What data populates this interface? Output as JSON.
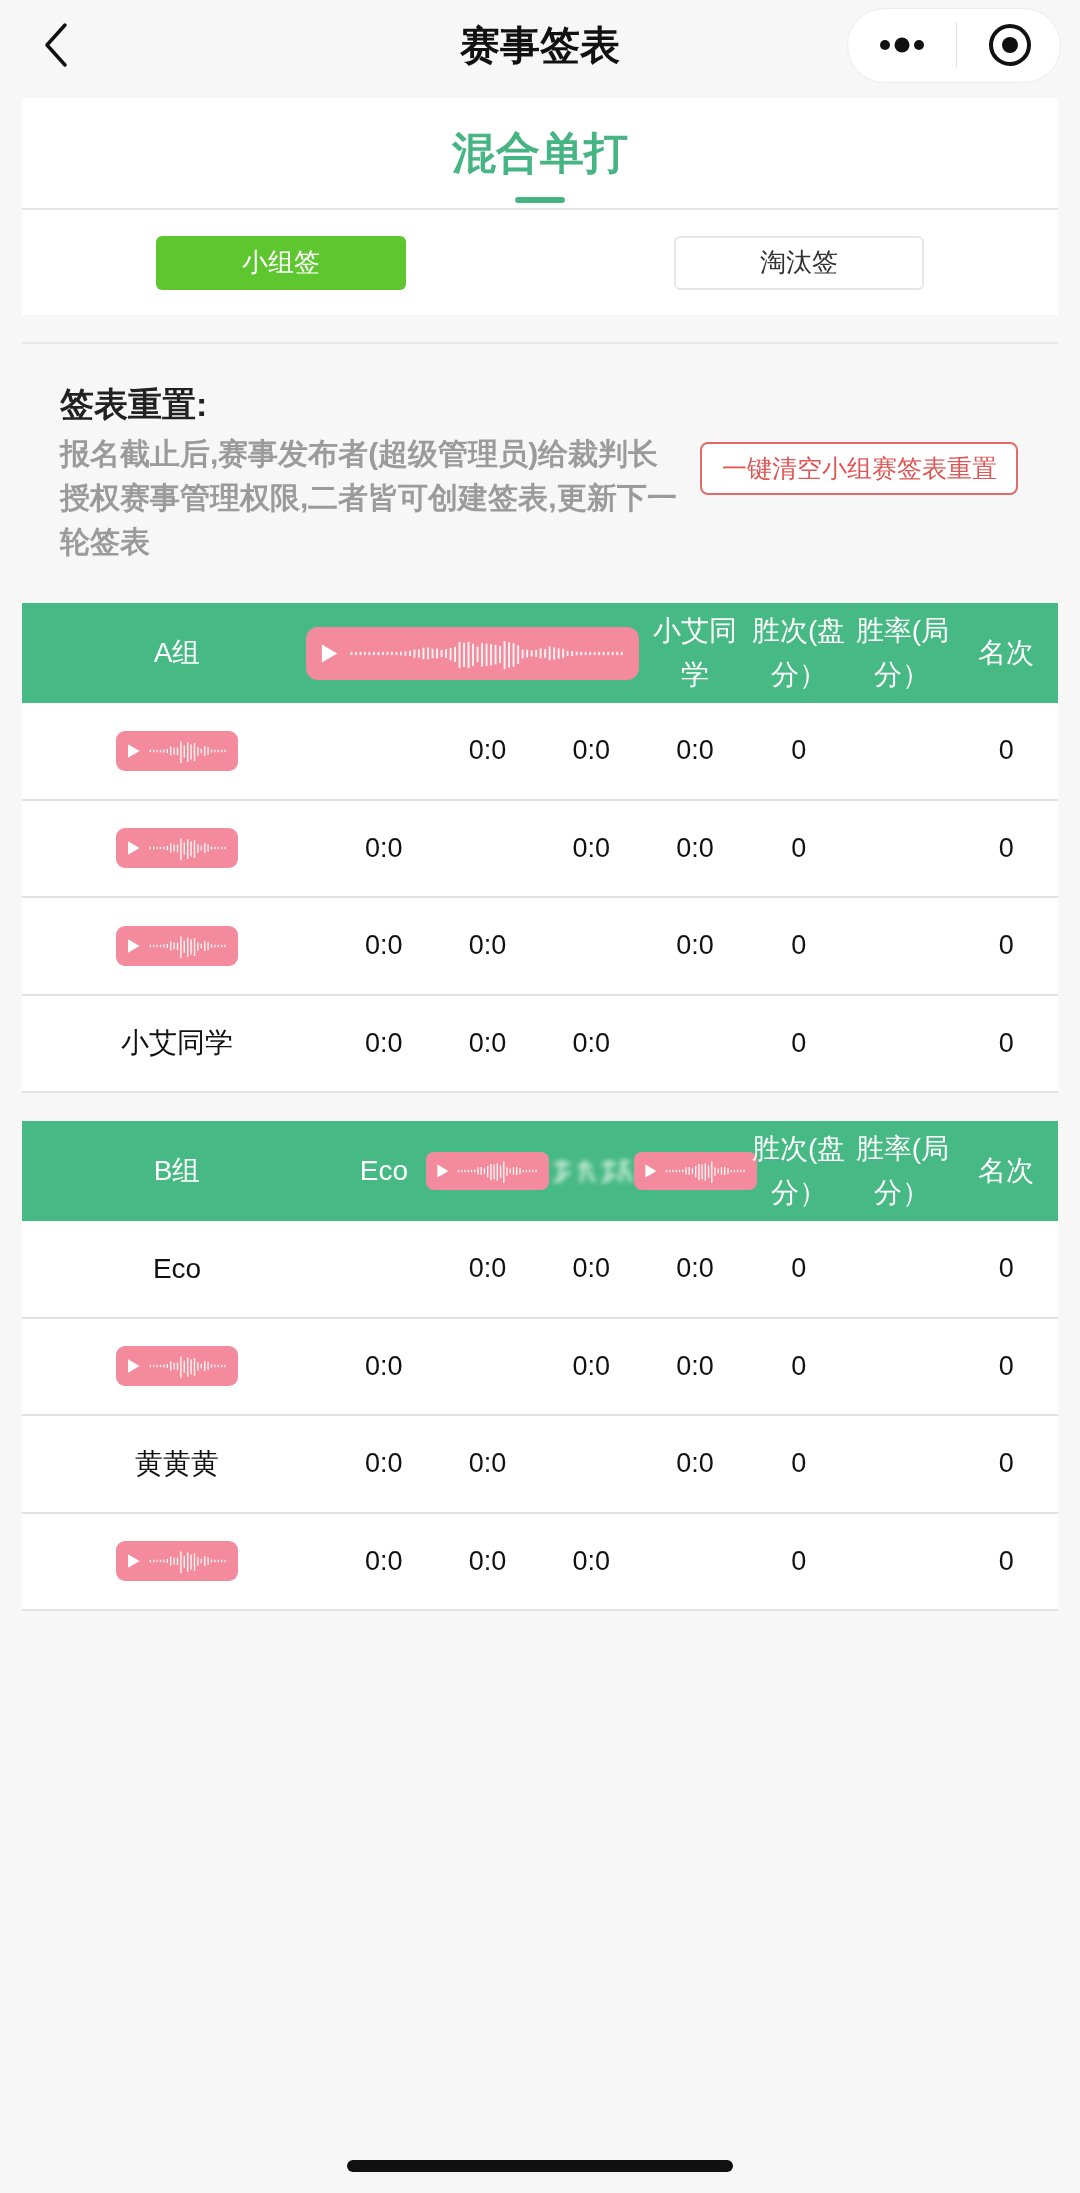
{
  "nav_bar": {
    "title": "赛事签表"
  },
  "event": {
    "title": "混合单打"
  },
  "draw_tabs": [
    {
      "label": "小组签",
      "selected": true
    },
    {
      "label": "淘汰签",
      "selected": false
    }
  ],
  "reset_section": {
    "heading": "签表重置:",
    "description": "报名截止后,赛事发布者(超级管理员)给裁判长授权赛事管理权限,二者皆可创建签表,更新下一轮签表",
    "button": "一键清空小组赛签表重置"
  },
  "groups": [
    {
      "columns": [
        {
          "kind": "text",
          "label": "A组"
        },
        {
          "kind": "wide_sticker"
        },
        {
          "kind": "text",
          "label": "小艾同学"
        },
        {
          "kind": "text",
          "label": "胜次(盘分）"
        },
        {
          "kind": "text",
          "label": "胜率(局分）"
        },
        {
          "kind": "text",
          "label": "名次"
        }
      ],
      "rows": [
        {
          "player": {
            "kind": "sticker"
          },
          "scores": [
            "0:0",
            "0:0",
            "0:0"
          ],
          "wins": "0",
          "rank": "0"
        },
        {
          "player": {
            "kind": "sticker"
          },
          "scores": [
            "0:0",
            "0:0",
            "0:0"
          ],
          "wins": "0",
          "rank": "0"
        },
        {
          "player": {
            "kind": "sticker"
          },
          "scores": [
            "0:0",
            "0:0",
            "0:0"
          ],
          "wins": "0",
          "rank": "0"
        },
        {
          "player": {
            "kind": "text",
            "label": "小艾同学"
          },
          "scores": [
            "0:0",
            "0:0",
            "0:0"
          ],
          "wins": "0",
          "rank": "0"
        }
      ]
    },
    {
      "columns": [
        {
          "kind": "text",
          "label": "B组"
        },
        {
          "kind": "text",
          "label": "Eco"
        },
        {
          "kind": "sticker"
        },
        {
          "kind": "blurred"
        },
        {
          "kind": "sticker"
        },
        {
          "kind": "text",
          "label": "胜次(盘分）"
        },
        {
          "kind": "text",
          "label": "胜率(局分）"
        },
        {
          "kind": "text",
          "label": "名次"
        }
      ],
      "rows": [
        {
          "player": {
            "kind": "text",
            "label": "Eco"
          },
          "scores": [
            "0:0",
            "0:0",
            "0:0"
          ],
          "wins": "0",
          "rank": "0"
        },
        {
          "player": {
            "kind": "sticker"
          },
          "scores": [
            "0:0",
            "0:0",
            "0:0"
          ],
          "wins": "0",
          "rank": "0"
        },
        {
          "player": {
            "kind": "text",
            "label": "黄黄黄"
          },
          "scores": [
            "0:0",
            "0:0",
            "0:0"
          ],
          "wins": "0",
          "rank": "0"
        },
        {
          "player": {
            "kind": "sticker"
          },
          "scores": [
            "0:0",
            "0:0",
            "0:0"
          ],
          "wins": "0",
          "rank": "0"
        }
      ]
    }
  ]
}
